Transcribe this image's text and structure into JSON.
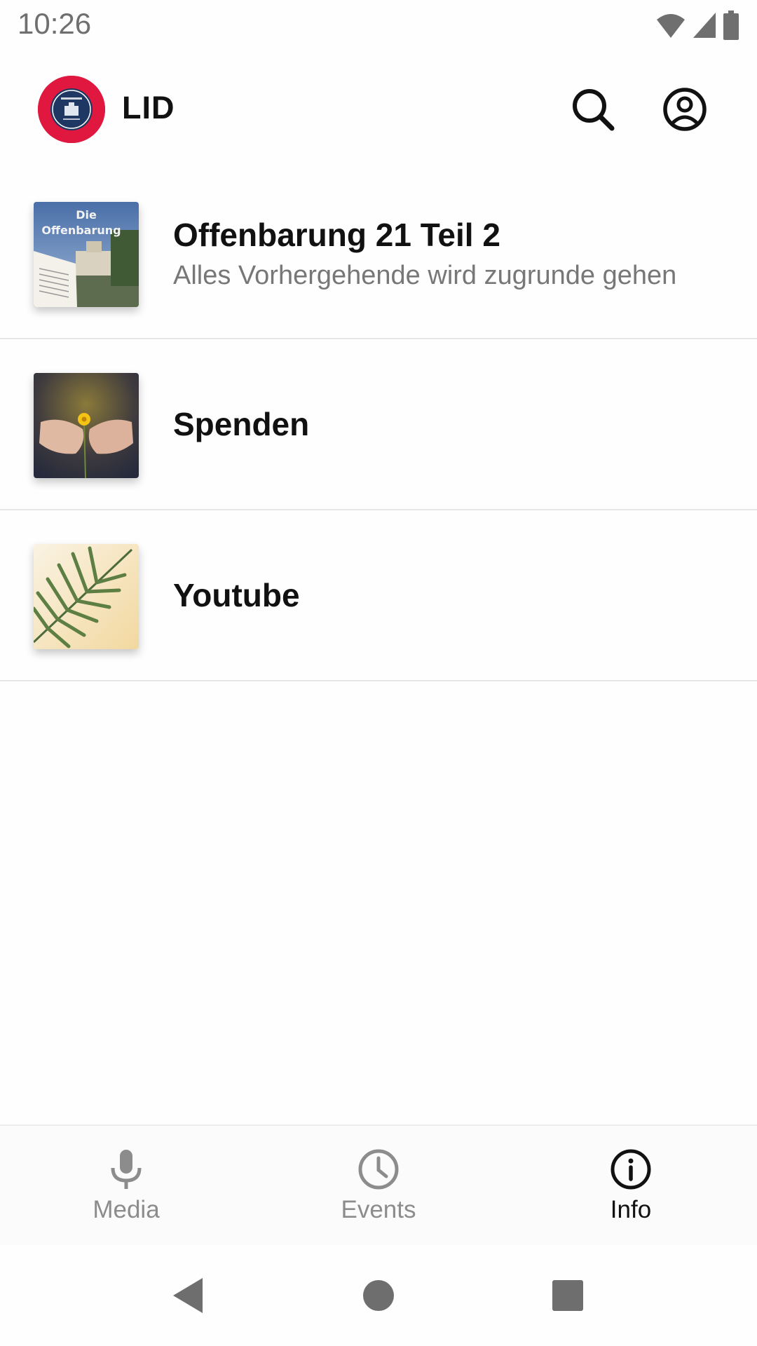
{
  "status_bar": {
    "time": "10:26",
    "icons": [
      "wifi-icon",
      "cell-signal-icon",
      "battery-icon"
    ]
  },
  "app_bar": {
    "title": "LID",
    "logo": "lid-logo",
    "actions": [
      "search-icon",
      "account-icon"
    ]
  },
  "list": {
    "items": [
      {
        "title": "Offenbarung 21  Teil 2",
        "subtitle": "Alles Vorhergehende wird zugrunde gehen",
        "thumb_text": [
          "Die",
          "Offenbarung"
        ]
      },
      {
        "title": "Spenden",
        "subtitle": ""
      },
      {
        "title": "Youtube",
        "subtitle": ""
      }
    ]
  },
  "bottom_nav": {
    "tabs": [
      {
        "label": "Media",
        "icon": "microphone-icon",
        "active": false
      },
      {
        "label": "Events",
        "icon": "clock-icon",
        "active": false
      },
      {
        "label": "Info",
        "icon": "info-icon",
        "active": true
      }
    ]
  },
  "system_nav": {
    "buttons": [
      "back-icon",
      "home-icon",
      "recents-icon"
    ]
  },
  "colors": {
    "logo_red": "#e0173f",
    "logo_navy": "#1f3763",
    "active_tab": "#111111",
    "inactive_tab": "#8c8c8c",
    "divider": "#e6e6e6"
  }
}
